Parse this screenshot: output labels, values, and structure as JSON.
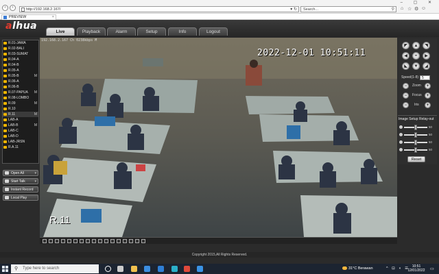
{
  "browser": {
    "url": "http://192.168.2.167/",
    "search_placeholder": "Search...",
    "tab_title": "PREVIEW",
    "tab_close": "×",
    "back": "‹",
    "forward": "›",
    "url_refresh": "▾ ↻",
    "chrome_icons": [
      "⌂",
      "☆",
      "⚙",
      "☺"
    ],
    "window_controls": "– ▢ ✕"
  },
  "app": {
    "logo_prefix": "a",
    "logo_rest": "lhua",
    "tabs": [
      "Live",
      "Playback",
      "Alarm",
      "Setup",
      "Info",
      "Logout"
    ],
    "active_tab": "Live",
    "footer": "Copyright 2015,All Rights Reserved."
  },
  "channels": [
    {
      "label": "R.01-JAWA",
      "m": ""
    },
    {
      "label": "R.02-BALI",
      "m": ""
    },
    {
      "label": "R.03-SUMAT",
      "m": ""
    },
    {
      "label": "R.04-A",
      "m": ""
    },
    {
      "label": "R.04-B",
      "m": ""
    },
    {
      "label": "R.05-A",
      "m": ""
    },
    {
      "label": "R.05-B",
      "m": "M"
    },
    {
      "label": "R.06-A",
      "m": ""
    },
    {
      "label": "R.06-B",
      "m": ""
    },
    {
      "label": "R.07-PAPUA",
      "m": "M"
    },
    {
      "label": "R.08-LOMBO",
      "m": ""
    },
    {
      "label": "R.09",
      "m": "M"
    },
    {
      "label": "R.10",
      "m": ""
    },
    {
      "label": "R.11",
      "m": "M"
    },
    {
      "label": "LAB-A",
      "m": ""
    },
    {
      "label": "LAB-B",
      "m": "M"
    },
    {
      "label": "LAB-C",
      "m": ""
    },
    {
      "label": "LAB-D",
      "m": ""
    },
    {
      "label": "LAB-JRSN",
      "m": ""
    },
    {
      "label": "R.A.11",
      "m": ""
    }
  ],
  "side_buttons": {
    "open_all": "Open All",
    "start_talk": "Start Talk",
    "instant_record": "Instant Record",
    "local_play": "Local Play",
    "dropdown": "▾"
  },
  "video": {
    "info": "192.168.2.167 Ch 0238kbps M",
    "timestamp": "2022-12-01 10:51:11",
    "label": "R.11"
  },
  "ptz": {
    "speed_label": "Speed(1-8)",
    "speed_value": "5",
    "zoom_label": "Zoom",
    "focus_label": "Focus",
    "iris_label": "Iris",
    "minus": "−",
    "plus": "+",
    "arrows": {
      "up": "▲",
      "down": "▼",
      "left": "◀",
      "right": "▶",
      "upleft": "◤",
      "upright": "◥",
      "downleft": "◣",
      "downright": "◢",
      "center": "⌖"
    }
  },
  "image_setup": {
    "tab_image": "Image Setup",
    "tab_relay": "Relay-out",
    "sliders": [
      {
        "name": "brightness",
        "value": 50,
        "label": "50"
      },
      {
        "name": "contrast",
        "value": 50,
        "label": "50"
      },
      {
        "name": "saturation",
        "value": 50,
        "label": "50"
      },
      {
        "name": "hue",
        "value": 50,
        "label": "50"
      }
    ],
    "reset": "Reset"
  },
  "taskbar": {
    "search_placeholder": "Type here to search",
    "search_icon": "⚲",
    "weather": "31°C  Berawan",
    "tray": "^ ⊡ ◖ ☰",
    "time": "10:51",
    "date": "12/01/2022",
    "notif": "▭",
    "icons": [
      {
        "name": "cortana-icon",
        "color": "#ffffff"
      },
      {
        "name": "task-view-icon",
        "color": "#cccccc"
      },
      {
        "name": "file-explorer-icon",
        "color": "#f2c14e"
      },
      {
        "name": "store-icon",
        "color": "#3b8de0"
      },
      {
        "name": "mail-icon",
        "color": "#2f7fd6"
      },
      {
        "name": "edge-icon",
        "color": "#2bb0c9"
      },
      {
        "name": "chrome-icon",
        "color": "#e0493b"
      },
      {
        "name": "ie-icon",
        "color": "#3a93e6"
      }
    ]
  }
}
